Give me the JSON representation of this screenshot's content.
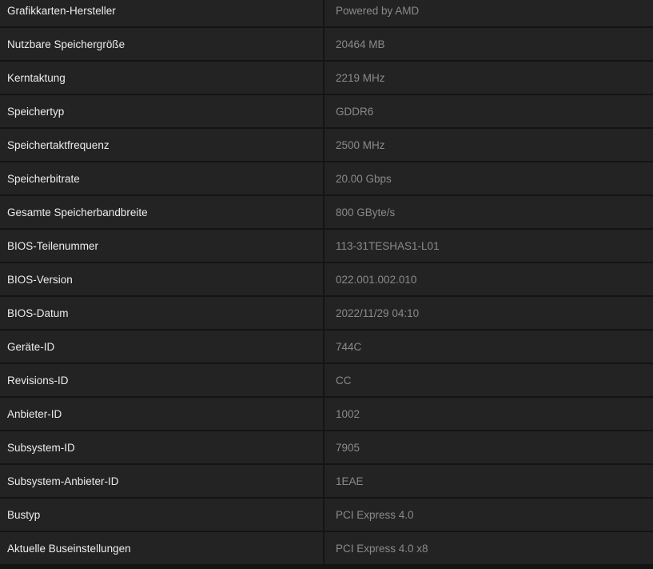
{
  "specs": [
    {
      "label": "Grafikkarten-Hersteller",
      "value": "Powered by AMD"
    },
    {
      "label": "Nutzbare Speichergröße",
      "value": "20464 MB"
    },
    {
      "label": "Kerntaktung",
      "value": "2219 MHz"
    },
    {
      "label": "Speichertyp",
      "value": "GDDR6"
    },
    {
      "label": "Speichertaktfrequenz",
      "value": "2500 MHz"
    },
    {
      "label": "Speicherbitrate",
      "value": "20.00 Gbps"
    },
    {
      "label": "Gesamte Speicherbandbreite",
      "value": "800 GByte/s"
    },
    {
      "label": "BIOS-Teilenummer",
      "value": "113-31TESHAS1-L01"
    },
    {
      "label": "BIOS-Version",
      "value": "022.001.002.010"
    },
    {
      "label": "BIOS-Datum",
      "value": "2022/11/29 04:10"
    },
    {
      "label": "Geräte-ID",
      "value": "744C"
    },
    {
      "label": "Revisions-ID",
      "value": "CC"
    },
    {
      "label": "Anbieter-ID",
      "value": "1002"
    },
    {
      "label": "Subsystem-ID",
      "value": "7905"
    },
    {
      "label": "Subsystem-Anbieter-ID",
      "value": "1EAE"
    },
    {
      "label": "Bustyp",
      "value": "PCI Express 4.0"
    },
    {
      "label": "Aktuelle Buseinstellungen",
      "value": "PCI Express 4.0 x8"
    }
  ]
}
